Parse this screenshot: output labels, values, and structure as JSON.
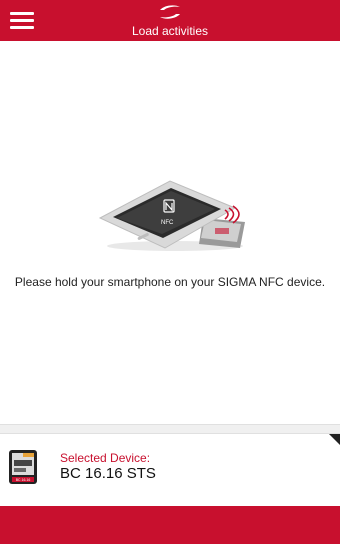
{
  "header": {
    "title": "Load activities"
  },
  "main": {
    "instruction": "Please hold your smartphone on your SIGMA NFC device.",
    "phone_label": "NFC"
  },
  "device": {
    "label": "Selected Device:",
    "name": "BC 16.16 STS",
    "thumb_text": "BC 16.16"
  },
  "colors": {
    "accent": "#c8102e"
  }
}
